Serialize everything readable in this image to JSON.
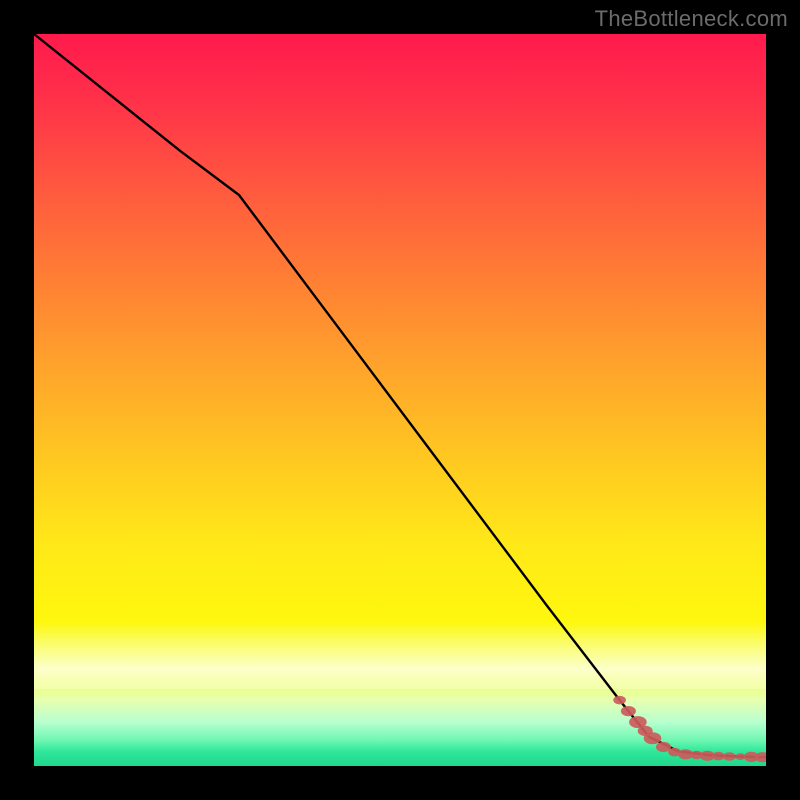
{
  "watermark": "TheBottleneck.com",
  "colors": {
    "background": "#000000",
    "line": "#000000",
    "marker": "#cc5b5b",
    "marker_stroke": "#cc5b5b"
  },
  "chart_data": {
    "type": "line",
    "title": "",
    "xlabel": "",
    "ylabel": "",
    "xlim": [
      0,
      100
    ],
    "ylim": [
      0,
      100
    ],
    "grid": false,
    "series": [
      {
        "name": "bottleneck-curve",
        "x": [
          0,
          10,
          20,
          28,
          40,
          55,
          70,
          80,
          84,
          88,
          92,
          96,
          100
        ],
        "values": [
          100,
          92,
          84,
          78,
          62,
          42,
          22,
          9,
          4,
          2,
          1.5,
          1.3,
          1.2
        ]
      }
    ],
    "markers": {
      "name": "highlighted-points",
      "color": "#cc5b5b",
      "points": [
        {
          "x": 80.0,
          "y": 9.0,
          "r": 5
        },
        {
          "x": 81.2,
          "y": 7.5,
          "r": 6
        },
        {
          "x": 82.5,
          "y": 6.0,
          "r": 7
        },
        {
          "x": 83.5,
          "y": 4.8,
          "r": 6
        },
        {
          "x": 84.5,
          "y": 3.8,
          "r": 7
        },
        {
          "x": 86.0,
          "y": 2.6,
          "r": 6
        },
        {
          "x": 87.5,
          "y": 1.9,
          "r": 5
        },
        {
          "x": 89.0,
          "y": 1.6,
          "r": 6
        },
        {
          "x": 90.5,
          "y": 1.5,
          "r": 5
        },
        {
          "x": 92.0,
          "y": 1.4,
          "r": 6
        },
        {
          "x": 93.5,
          "y": 1.35,
          "r": 5
        },
        {
          "x": 95.0,
          "y": 1.3,
          "r": 5
        },
        {
          "x": 96.5,
          "y": 1.28,
          "r": 4
        },
        {
          "x": 98.0,
          "y": 1.25,
          "r": 6
        },
        {
          "x": 99.5,
          "y": 1.2,
          "r": 6
        }
      ]
    }
  }
}
